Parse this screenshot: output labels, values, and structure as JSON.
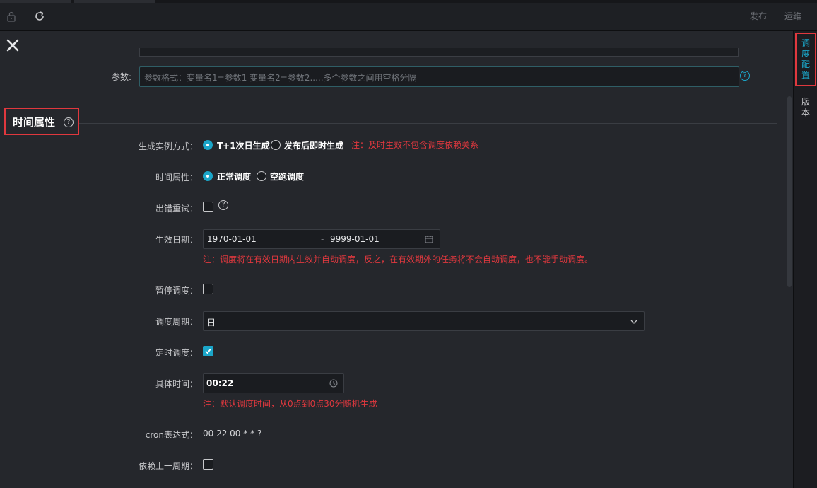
{
  "topbar": {
    "publish_label": "发布",
    "ops_label": "运维"
  },
  "params": {
    "label": "参数:",
    "placeholder": "参数格式：变量名1=参数1 变量名2=参数2.....多个参数之间用空格分隔"
  },
  "section": {
    "title": "时间属性"
  },
  "form": {
    "instance_mode": {
      "label": "生成实例方式：",
      "options": [
        "T+1次日生成",
        "发布后即时生成"
      ],
      "selected": 0,
      "note": "注：及时生效不包含调度依赖关系"
    },
    "time_attr": {
      "label": "时间属性：",
      "options": [
        "正常调度",
        "空跑调度"
      ],
      "selected": 0
    },
    "retry": {
      "label": "出错重试：",
      "checked": false
    },
    "effective_date": {
      "label": "生效日期：",
      "start": "1970-01-01",
      "separator": "-",
      "end": "9999-01-01",
      "note": "注：调度将在有效日期内生效并自动调度，反之，在有效期外的任务将不会自动调度，也不能手动调度。"
    },
    "pause": {
      "label": "暂停调度：",
      "checked": false
    },
    "cycle": {
      "label": "调度周期：",
      "value": "日"
    },
    "timed": {
      "label": "定时调度：",
      "checked": true
    },
    "specific_time": {
      "label": "具体时间：",
      "value": "00:22",
      "note": "注：默认调度时间，从0点到0点30分随机生成"
    },
    "cron": {
      "label": "cron表达式：",
      "value": "00 22 00 * * ?"
    },
    "depend_prev": {
      "label": "依赖上一周期：",
      "checked": false
    }
  },
  "sidebar": {
    "tabs": [
      {
        "label": [
          "调",
          "度",
          "配",
          "置"
        ],
        "active": true
      },
      {
        "label": [
          "版",
          "本"
        ],
        "active": false
      }
    ]
  },
  "colors": {
    "accent": "#1ba6c9",
    "warning": "#e0383e",
    "background": "#25272c"
  }
}
